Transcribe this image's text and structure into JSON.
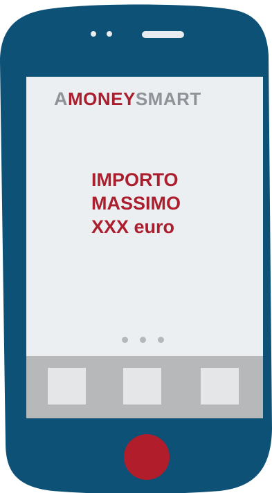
{
  "brand": {
    "prefix": "A",
    "money": "MONEY",
    "smart": "SMART"
  },
  "headline": {
    "line1": "IMPORTO",
    "line2": "MASSIMO",
    "line3": "XXX euro"
  },
  "colors": {
    "phone_body": "#0d5176",
    "screen": "#eceff1",
    "accent_red": "#aa1e2d",
    "logo_grey": "#8f9297",
    "dock": "#b6b8ba",
    "app_tile": "#e4e6e8",
    "home_button": "#b11d2a"
  },
  "dock": {
    "apps": [
      "app-icon",
      "app-icon",
      "app-icon"
    ]
  },
  "pagination": {
    "pages": 3
  }
}
